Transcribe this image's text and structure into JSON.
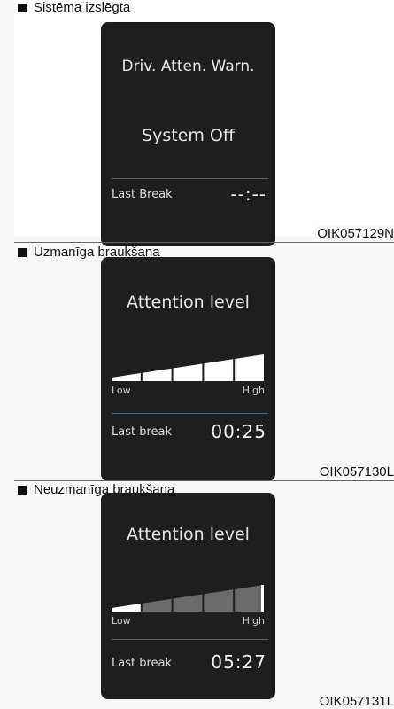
{
  "sections": [
    {
      "caption": "Sistēma izslēgta",
      "code": "OIK057129N",
      "screen": {
        "title": "Driv. Atten. Warn.",
        "status": "System Off",
        "last_break_label": "Last Break",
        "last_break_value": "--:--"
      }
    },
    {
      "caption": "Uzmanīga braukšana",
      "code": "OIK057130L",
      "screen": {
        "title": "Attention level",
        "low_label": "Low",
        "high_label": "High",
        "attention_level_fraction": 1.0,
        "last_break_label": "Last break",
        "last_break_value": "00:25"
      }
    },
    {
      "caption": "Neuzmanīga braukšana",
      "code": "OIK057131L",
      "screen": {
        "title": "Attention level",
        "low_label": "Low",
        "high_label": "High",
        "attention_level_fraction": 0.2,
        "last_break_label": "Last break",
        "last_break_value": "05:27"
      }
    }
  ],
  "colors": {
    "screen_bg": "#1e1e1e",
    "divider": "#3d6b87",
    "gauge_active": "#ffffff",
    "gauge_inactive": "#6a6a6a"
  }
}
